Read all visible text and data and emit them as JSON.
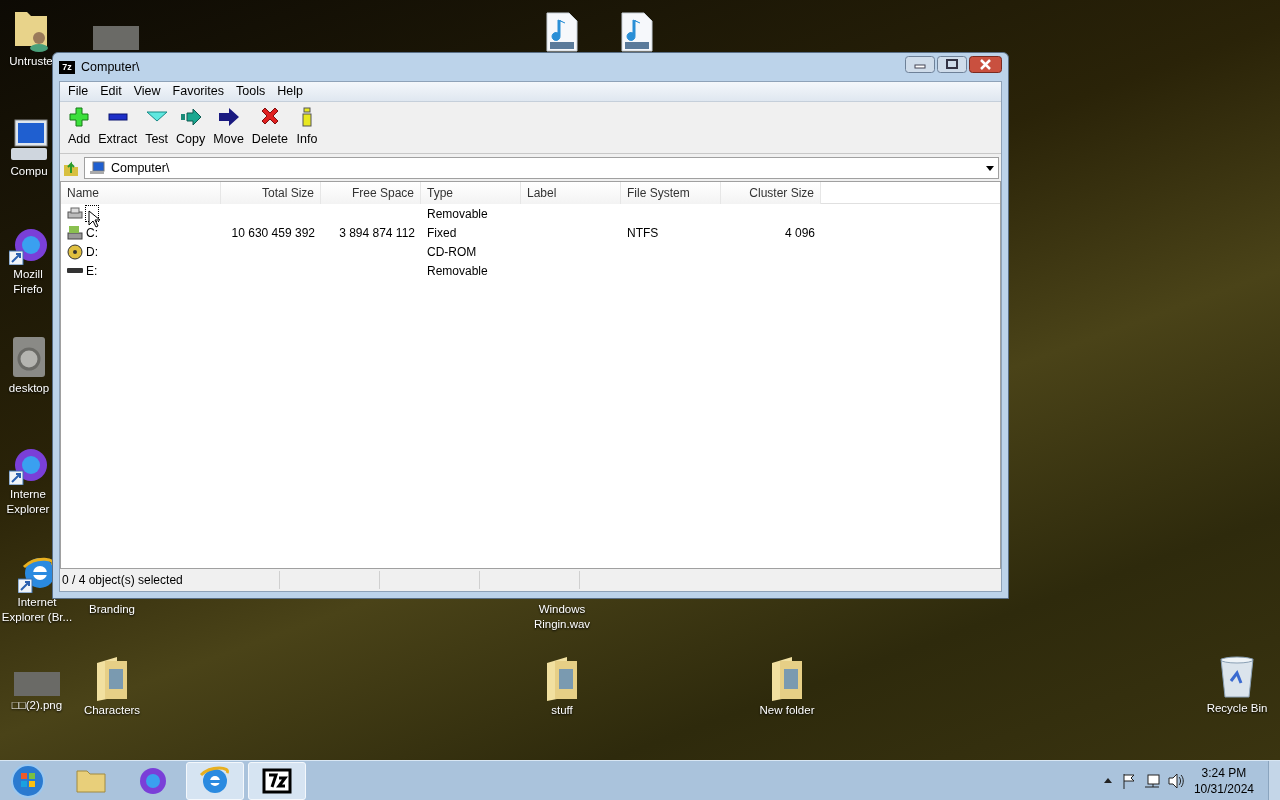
{
  "desktop": {
    "icons": [
      {
        "kind": "user-folder",
        "label": "Untruste"
      },
      {
        "kind": "photo"
      },
      {
        "kind": "wav"
      },
      {
        "kind": "wav"
      },
      {
        "kind": "computer",
        "label": "Compu"
      },
      {
        "kind": "firefox",
        "label": "Mozill Firefo"
      },
      {
        "kind": "gear",
        "label": "desktop"
      },
      {
        "kind": "firefox",
        "label": "Interne Explorer"
      },
      {
        "kind": "ie",
        "label": "Internet Explorer (Br..."
      },
      {
        "kind": "none",
        "label": "Branding"
      },
      {
        "kind": "none",
        "label": "Windows Ringin.wav"
      },
      {
        "kind": "photo",
        "label": "□□(2).png"
      },
      {
        "kind": "folder",
        "label": "Characters"
      },
      {
        "kind": "folder",
        "label": "stuff"
      },
      {
        "kind": "folder",
        "label": "New folder"
      },
      {
        "kind": "recycle",
        "label": "Recycle Bin"
      }
    ]
  },
  "window": {
    "title": "Computer\\",
    "menu": [
      "File",
      "Edit",
      "View",
      "Favorites",
      "Tools",
      "Help"
    ],
    "toolbar": [
      {
        "kind": "add",
        "label": "Add"
      },
      {
        "kind": "extract",
        "label": "Extract"
      },
      {
        "kind": "test",
        "label": "Test"
      },
      {
        "kind": "copy",
        "label": "Copy"
      },
      {
        "kind": "move",
        "label": "Move"
      },
      {
        "kind": "delete",
        "label": "Delete"
      },
      {
        "kind": "info",
        "label": "Info"
      }
    ],
    "address": "Computer\\",
    "columns": [
      "Name",
      "Total Size",
      "Free Space",
      "Type",
      "Label",
      "File System",
      "Cluster Size"
    ],
    "rows": [
      {
        "kind": "floppy",
        "focused": true,
        "cells": [
          "",
          "",
          "",
          "Removable",
          "",
          "",
          ""
        ]
      },
      {
        "kind": "hdd",
        "focused": false,
        "cells": [
          "C:",
          "10 630 459 392",
          "3 894 874 112",
          "Fixed",
          "",
          "NTFS",
          "4 096"
        ]
      },
      {
        "kind": "cdrom",
        "focused": false,
        "cells": [
          "D:",
          "",
          "",
          "CD-ROM",
          "",
          "",
          ""
        ]
      },
      {
        "kind": "removable",
        "focused": false,
        "cells": [
          "E:",
          "",
          "",
          "Removable",
          "",
          "",
          ""
        ]
      }
    ],
    "status": "0 / 4 object(s) selected"
  },
  "taskbar": {
    "items": [
      {
        "kind": "explorer",
        "running": false
      },
      {
        "kind": "firefox",
        "running": false
      },
      {
        "kind": "ie",
        "running": true
      },
      {
        "kind": "7z",
        "running": true
      }
    ],
    "tray": {
      "time": "3:24 PM",
      "date": "10/31/2024"
    }
  }
}
